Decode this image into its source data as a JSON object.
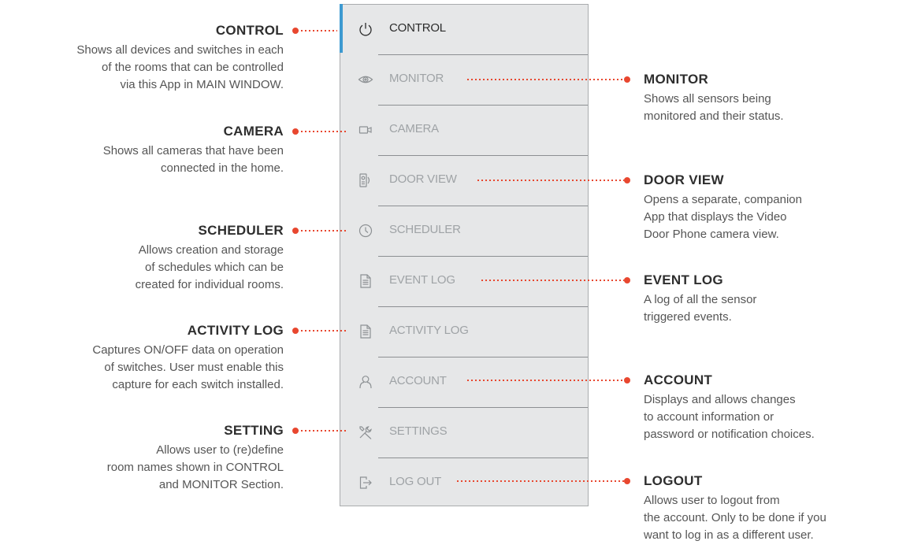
{
  "menu": {
    "items": [
      {
        "key": "control",
        "label": "CONTROL",
        "icon": "power-icon",
        "active": true
      },
      {
        "key": "monitor",
        "label": "MONITOR",
        "icon": "eye-icon"
      },
      {
        "key": "camera",
        "label": "CAMERA",
        "icon": "camera-icon"
      },
      {
        "key": "door-view",
        "label": "DOOR VIEW",
        "icon": "door-phone-icon"
      },
      {
        "key": "scheduler",
        "label": "SCHEDULER",
        "icon": "clock-icon"
      },
      {
        "key": "event-log",
        "label": "EVENT LOG",
        "icon": "document-icon"
      },
      {
        "key": "activity-log",
        "label": "ACTIVITY LOG",
        "icon": "document-icon"
      },
      {
        "key": "account",
        "label": "ACCOUNT",
        "icon": "user-icon"
      },
      {
        "key": "settings",
        "label": "SETTINGS",
        "icon": "tools-icon"
      },
      {
        "key": "log-out",
        "label": "LOG OUT",
        "icon": "logout-icon"
      }
    ]
  },
  "annotations": {
    "control": {
      "title": "CONTROL",
      "desc": "Shows all devices and switches in each\nof the rooms that can be controlled\nvia this App in MAIN WINDOW."
    },
    "monitor": {
      "title": "MONITOR",
      "desc": "Shows all sensors being\nmonitored and their status."
    },
    "camera": {
      "title": "CAMERA",
      "desc": "Shows all cameras that have been\nconnected in the home."
    },
    "door_view": {
      "title": "DOOR VIEW",
      "desc": "Opens a separate, companion\nApp that displays the Video\nDoor Phone camera view."
    },
    "scheduler": {
      "title": "SCHEDULER",
      "desc": "Allows creation and storage\nof schedules which can be\ncreated for individual rooms."
    },
    "event_log": {
      "title": "EVENT LOG",
      "desc": "A log of all the sensor\ntriggered events."
    },
    "activity_log": {
      "title": "ACTIVITY LOG",
      "desc": "Captures ON/OFF data on operation\nof switches. User must enable this\ncapture for each switch installed."
    },
    "account": {
      "title": "ACCOUNT",
      "desc": "Displays and allows changes\nto account information or\npassword or notification choices."
    },
    "setting": {
      "title": "SETTING",
      "desc": "Allows user to (re)define\nroom names shown in CONTROL\nand MONITOR Section."
    },
    "logout": {
      "title": "LOGOUT",
      "desc": "Allows user to logout from\nthe account. Only to be done if you\nwant to log in as a different user."
    }
  },
  "colors": {
    "accent_blue": "#3d9ad1",
    "connector_red": "#e8472f",
    "menu_bg": "#e6e7e8"
  }
}
